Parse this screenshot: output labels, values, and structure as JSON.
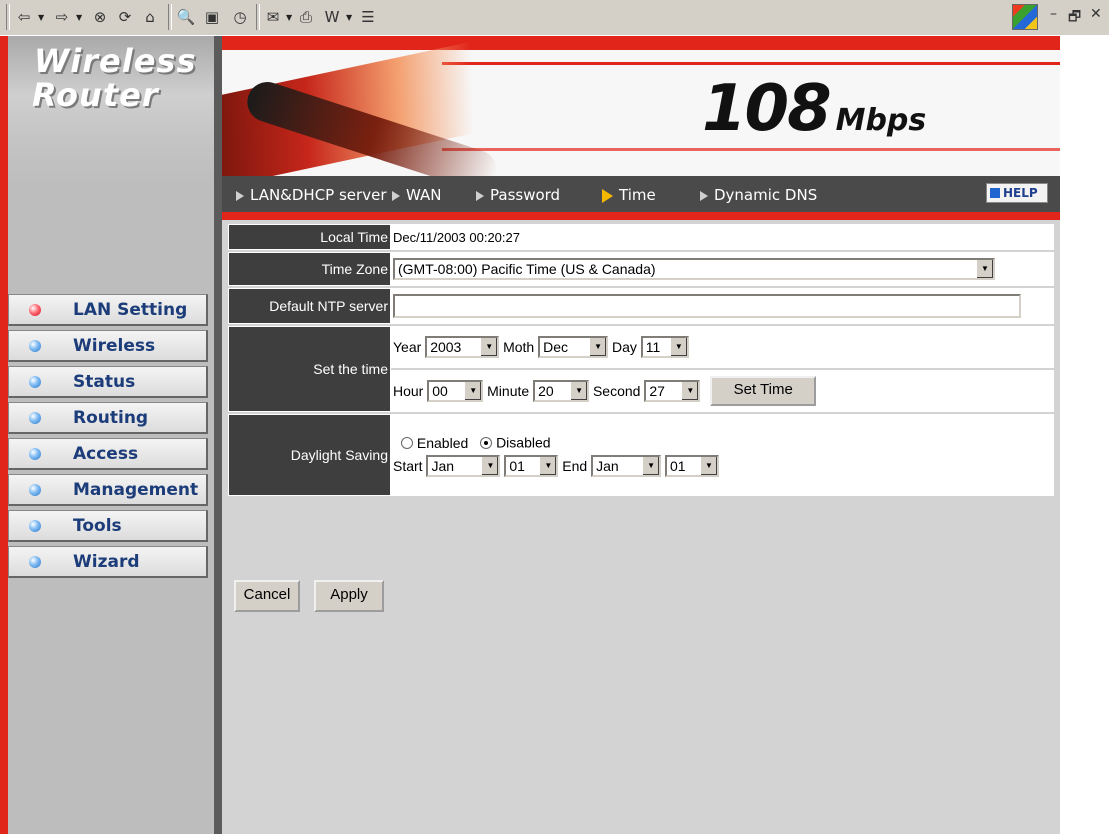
{
  "toolbar": {
    "icons": [
      "back-icon",
      "forward-icon",
      "stop-icon",
      "refresh-icon",
      "home-icon",
      "search-icon",
      "favorites-icon",
      "media-icon",
      "history-icon",
      "mail-icon",
      "print-icon",
      "edit-icon",
      "discuss-icon"
    ],
    "win_min": "–",
    "win_restore": "🗗",
    "win_close": "✕"
  },
  "logo": {
    "line1": "Wireless",
    "line2": "Router"
  },
  "menu": [
    {
      "label": "LAN Setting",
      "active": true
    },
    {
      "label": "Wireless",
      "active": false
    },
    {
      "label": "Status",
      "active": false
    },
    {
      "label": "Routing",
      "active": false
    },
    {
      "label": "Access",
      "active": false
    },
    {
      "label": "Management",
      "active": false
    },
    {
      "label": "Tools",
      "active": false
    },
    {
      "label": "Wizard",
      "active": false
    }
  ],
  "banner": {
    "speed": "108",
    "unit": "Mbps"
  },
  "nav": {
    "items": [
      "LAN&DHCP server",
      "WAN",
      "Password",
      "Time",
      "Dynamic DNS"
    ],
    "active": "Time",
    "help": "HELP"
  },
  "form": {
    "local_time_label": "Local Time",
    "local_time_value": "Dec/11/2003 00:20:27",
    "time_zone_label": "Time Zone",
    "time_zone_value": "(GMT-08:00) Pacific Time (US & Canada)",
    "ntp_label": "Default NTP server",
    "ntp_value": "",
    "set_time_label": "Set the time",
    "year_label": "Year",
    "year_value": "2003",
    "month_label": "Moth",
    "month_value": "Dec",
    "day_label": "Day",
    "day_value": "11",
    "hour_label": "Hour",
    "hour_value": "00",
    "minute_label": "Minute",
    "minute_value": "20",
    "second_label": "Second",
    "second_value": "27",
    "set_time_button": "Set Time",
    "daylight_label": "Daylight Saving",
    "enabled_label": "Enabled",
    "disabled_label": "Disabled",
    "daylight_selected": "Disabled",
    "start_label": "Start",
    "start_month": "Jan",
    "start_day": "01",
    "end_label": "End",
    "end_month": "Jan",
    "end_day": "01"
  },
  "actions": {
    "cancel": "Cancel",
    "apply": "Apply"
  }
}
